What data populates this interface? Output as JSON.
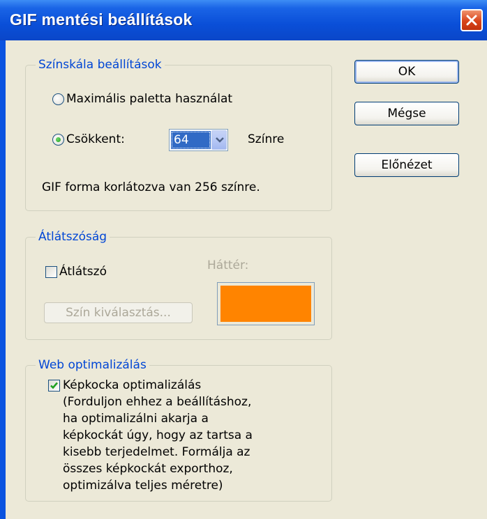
{
  "window": {
    "title": "GIF mentési beállítások",
    "close_icon": "close-icon"
  },
  "color_settings": {
    "legend": "Színskála beállítások",
    "max_palette_label": "Maximális paletta használat",
    "max_palette_selected": false,
    "reduced_label": "Csökkent:",
    "reduced_selected": true,
    "color_count_value": "64",
    "colors_suffix": "Színre",
    "note": "GIF forma korlátozva van 256 színre."
  },
  "transparency": {
    "legend": "Átlátszóság",
    "transparent_label": "Átlátszó",
    "transparent_checked": false,
    "background_label": "Háttér:",
    "background_color": "#ff8400",
    "choose_color_label": "Szín kiválasztás..."
  },
  "web_optimization": {
    "legend": "Web optimalizálás",
    "frame_opt_checked": true,
    "frame_opt_lines": [
      "Képkocka optimalizálás",
      "(Forduljon ehhez a beállításhoz,",
      "ha optimalizálni akarja a",
      "képkockát úgy, hogy az tartsa a",
      "kisebb terjedelmet. Formálja az",
      "összes képkockát exporthoz,",
      "optimizálva teljes méretre)"
    ]
  },
  "buttons": {
    "ok": "OK",
    "cancel": "Mégse",
    "preview": "Előnézet"
  }
}
